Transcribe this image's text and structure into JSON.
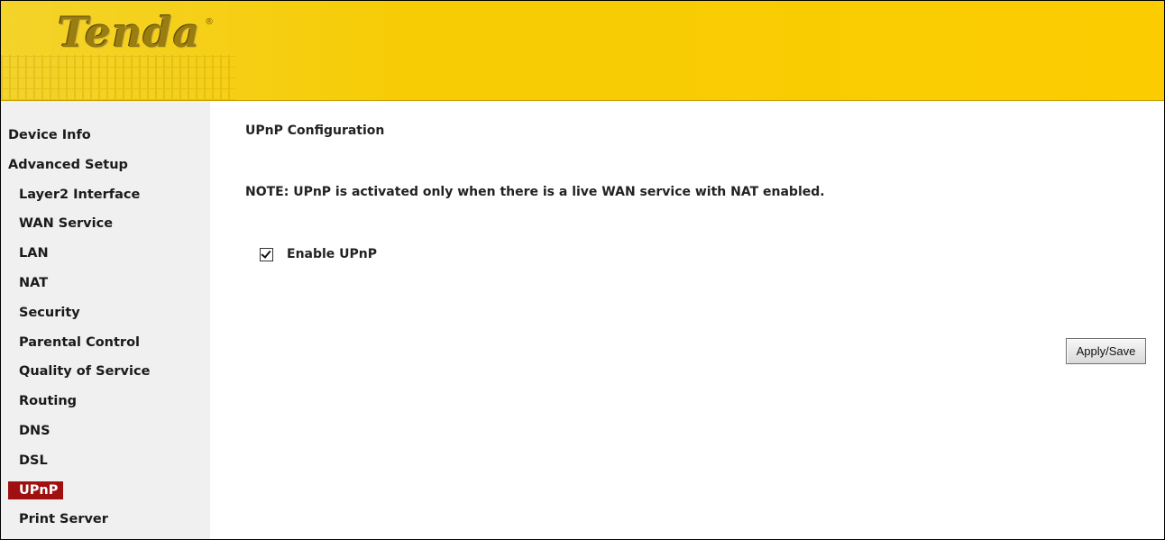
{
  "brand": {
    "logo_text": "Tenda",
    "reg_mark": "®",
    "header_color": "#fbcc00",
    "active_color": "#a01010"
  },
  "sidebar": {
    "items": [
      {
        "label": "Device Info",
        "level": "top"
      },
      {
        "label": "Advanced Setup",
        "level": "top"
      },
      {
        "label": "Layer2 Interface",
        "level": "sub"
      },
      {
        "label": "WAN Service",
        "level": "sub"
      },
      {
        "label": "LAN",
        "level": "sub"
      },
      {
        "label": "NAT",
        "level": "sub"
      },
      {
        "label": "Security",
        "level": "sub"
      },
      {
        "label": "Parental Control",
        "level": "sub"
      },
      {
        "label": "Quality of Service",
        "level": "sub"
      },
      {
        "label": "Routing",
        "level": "sub"
      },
      {
        "label": "DNS",
        "level": "sub"
      },
      {
        "label": "DSL",
        "level": "sub"
      },
      {
        "label": "UPnP",
        "level": "sub",
        "active": true
      },
      {
        "label": "Print Server",
        "level": "sub"
      }
    ]
  },
  "main": {
    "title": "UPnP Configuration",
    "note": "NOTE: UPnP is activated only when there is a live WAN service with NAT enabled.",
    "enable_upnp": {
      "label": "Enable UPnP",
      "checked": true
    },
    "apply_label": "Apply/Save"
  }
}
